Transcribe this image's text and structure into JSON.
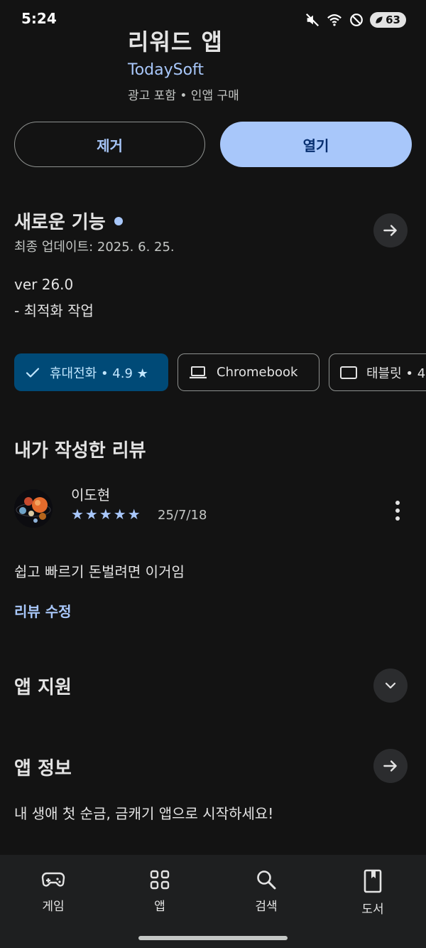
{
  "status": {
    "time": "5:24",
    "battery": "63"
  },
  "app": {
    "title": "리워드 앱",
    "developer": "TodaySoft",
    "meta": "광고 포함 • 인앱 구매"
  },
  "actions": {
    "remove": "제거",
    "open": "열기"
  },
  "whats_new": {
    "title": "새로운 기능",
    "updated": "최종 업데이트: 2025. 6. 25.",
    "version": "ver 26.0",
    "notes": "- 최적화 작업"
  },
  "device_chips": [
    {
      "label": "휴대전화 • 4.9 ★",
      "selected": true
    },
    {
      "label": "Chromebook",
      "selected": false
    },
    {
      "label": "태블릿 • 4",
      "selected": false
    }
  ],
  "my_review": {
    "title": "내가 작성한 리뷰",
    "reviewer": "이도현",
    "rating": 5,
    "stars": "★★★★★",
    "date": "25/7/18",
    "text": "쉽고 빠르기 돈벌려면 이거임",
    "edit_label": "리뷰 수정"
  },
  "app_support": {
    "title": "앱 지원"
  },
  "app_info": {
    "title": "앱 정보",
    "description": "내 생애 첫 순금, 금캐기 앱으로 시작하세요!"
  },
  "bottom_nav": [
    {
      "label": "게임",
      "icon": "gamepad-icon"
    },
    {
      "label": "앱",
      "icon": "apps-grid-icon"
    },
    {
      "label": "검색",
      "icon": "search-icon"
    },
    {
      "label": "도서",
      "icon": "book-icon"
    }
  ],
  "colors": {
    "background": "#131313",
    "accent": "#a8c7fa",
    "selected_chip": "#004a77"
  }
}
